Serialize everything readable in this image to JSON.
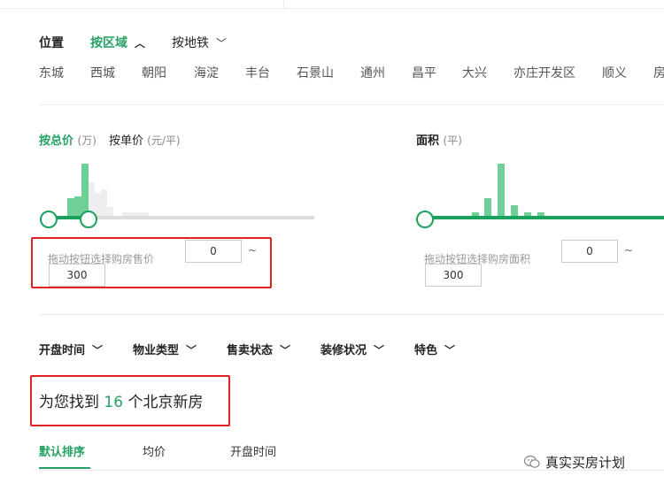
{
  "location": {
    "title": "位置",
    "tab_area": "按区域",
    "tab_subway": "按地铁",
    "districts": [
      "东城",
      "西城",
      "朝阳",
      "海淀",
      "丰台",
      "石景山",
      "通州",
      "昌平",
      "大兴",
      "亦庄开发区",
      "顺义",
      "房"
    ]
  },
  "price": {
    "tab_total": "按总价",
    "tab_total_unit": "(万)",
    "tab_unit": "按单价",
    "tab_unit_unit": "(元/平)",
    "hint": "拖动按钮选择购房售价",
    "min_value": "0",
    "tilde": "~",
    "max_value": "300"
  },
  "area": {
    "title": "面积",
    "title_unit": "(平)",
    "hint": "拖动按钮选择购房面积",
    "min_value": "0",
    "tilde": "~",
    "max_value": "300"
  },
  "filters": [
    "开盘时间",
    "物业类型",
    "售卖状态",
    "装修状况",
    "特色"
  ],
  "result": {
    "prefix": "为您找到",
    "count": "16",
    "suffix": "个北京新房"
  },
  "sort": {
    "options": [
      "默认排序",
      "均价",
      "开盘时间"
    ],
    "active": "默认排序"
  },
  "watermark": "真实买房计划",
  "colors": {
    "accent": "#25a164",
    "highlight_box": "#e22222"
  }
}
